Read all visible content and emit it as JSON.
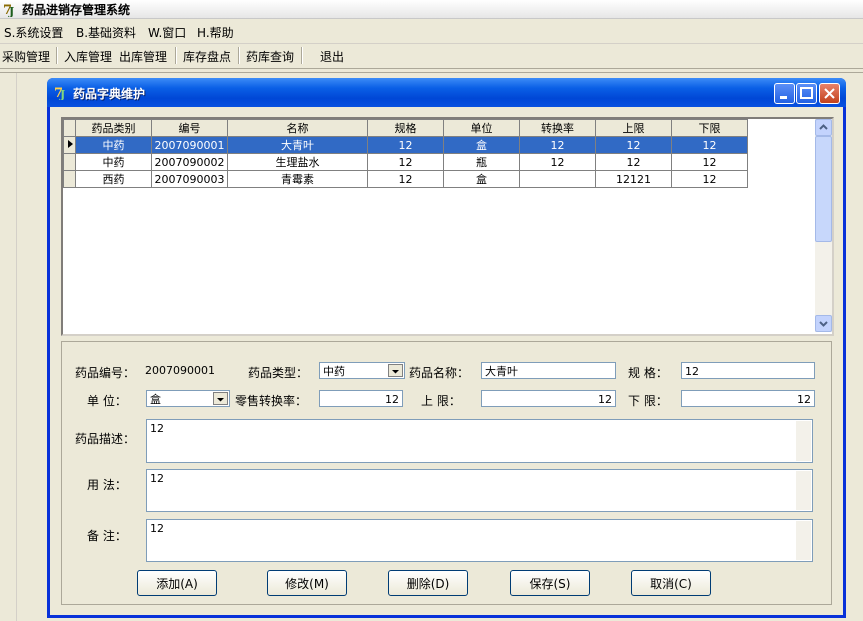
{
  "app": {
    "title": "药品进销存管理系统"
  },
  "menu": [
    {
      "label": "S.系统设置"
    },
    {
      "label": "B.基础资料"
    },
    {
      "label": "W.窗口"
    },
    {
      "label": "H.帮助"
    }
  ],
  "toolbar": {
    "purchase": "采购管理",
    "stock_in": "入库管理",
    "stock_out": "出库管理",
    "inventory": "库存盘点",
    "query": "药库查询",
    "exit": "退出"
  },
  "window": {
    "title": "药品字典维护"
  },
  "grid": {
    "columns": [
      "药品类别",
      "编号",
      "名称",
      "规格",
      "单位",
      "转换率",
      "上限",
      "下限"
    ],
    "rows": [
      [
        "中药",
        "2007090001",
        "大青叶",
        "12",
        "盒",
        "12",
        "12",
        "12"
      ],
      [
        "中药",
        "2007090002",
        "生理盐水",
        "12",
        "瓶",
        "12",
        "12",
        "12"
      ],
      [
        "西药",
        "2007090003",
        "青霉素",
        "12",
        "盒",
        "",
        "12121",
        "12"
      ]
    ],
    "selected_row": 0
  },
  "form": {
    "code_label": "药品编号：",
    "code_value": "2007090001",
    "type_label": "药品类型：",
    "type_value": "中药",
    "name_label": "药品名称：",
    "name_value": "大青叶",
    "spec_label": "规  格：",
    "spec_value": "12",
    "unit_label": "单  位：",
    "unit_value": "盒",
    "rate_label": "零售转换率：",
    "rate_value": "12",
    "upper_label": "上  限：",
    "upper_value": "12",
    "lower_label": "下  限：",
    "lower_value": "12",
    "desc_label": "药品描述：",
    "desc_value": "12",
    "usage_label": "用  法：",
    "usage_value": "12",
    "remark_label": "备  注：",
    "remark_value": "12"
  },
  "buttons": {
    "add": "添加(A)",
    "modify": "修改(M)",
    "delete": "删除(D)",
    "save": "保存(S)",
    "cancel": "取消(C)"
  }
}
